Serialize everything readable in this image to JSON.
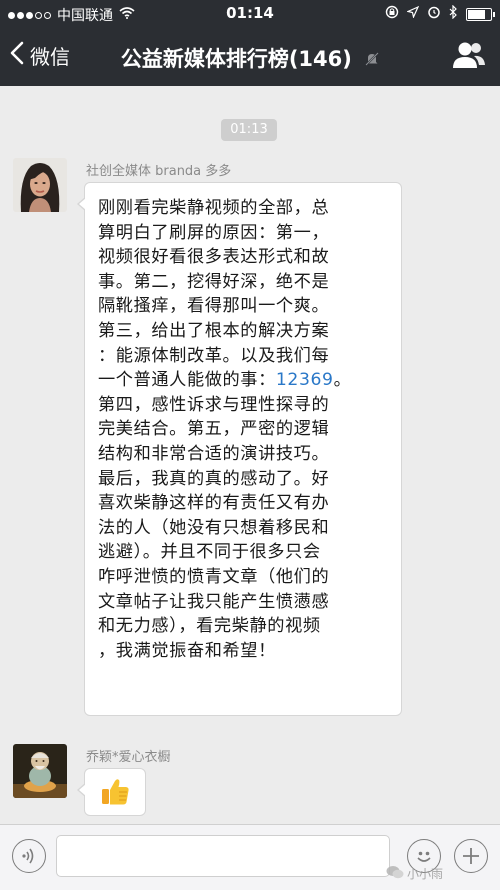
{
  "status_bar": {
    "carrier": "中国联通",
    "time": "01:14",
    "battery_level": 0.85,
    "icons": [
      "signal-dots-icon",
      "wifi-icon",
      "lock-rotation-icon",
      "location-icon",
      "alarm-icon",
      "bluetooth-icon",
      "battery-icon"
    ]
  },
  "nav": {
    "back_label": "微信",
    "title": "公益新媒体排行榜(146)",
    "icons": [
      "back-chevron-icon",
      "mute-bell-icon",
      "profile-icon"
    ]
  },
  "chat": {
    "timestamp": "01:13",
    "messages": [
      {
        "sender": "社创全媒体  branda 多多",
        "lines": [
          "刚刚看完柴静视频的全部，总",
          "算明白了刷屏的原因：第一，",
          "视频很好看很多表达形式和故",
          "事。第二，挖得好深，绝不是",
          "隔靴搔痒，看得那叫一个爽。",
          "第三，给出了根本的解决方案",
          "：能源体制改革。以及我们每",
          "一个普通人能做的事：",
          "第四，感性诉求与理性探寻的",
          "完美结合。第五，严密的逻辑",
          "结构和非常合适的演讲技巧。",
          "最后，我真的真的感动了。好",
          "喜欢柴静这样的有责任又有办",
          "法的人（她没有只想着移民和",
          "逃避）。并且不同于很多只会",
          "咋呼泄愤的愤青文章（他们的",
          "文章帖子让我只能产生愤懑感",
          "和无力感），看完柴静的视频",
          "，我满觉振奋和希望！"
        ],
        "link_number": "12369",
        "link_suffix": "。"
      },
      {
        "sender": "乔颖*爱心衣橱",
        "emoji": "thumbs-up-emoji"
      }
    ]
  },
  "input": {
    "placeholder": "",
    "watermark": "小小雨",
    "icons": [
      "voice-icon",
      "emoji-face-icon",
      "plus-icon"
    ]
  },
  "colors": {
    "bar_dark": "#2b2e33",
    "chat_bg": "#ececec",
    "link": "#2a78c8"
  }
}
